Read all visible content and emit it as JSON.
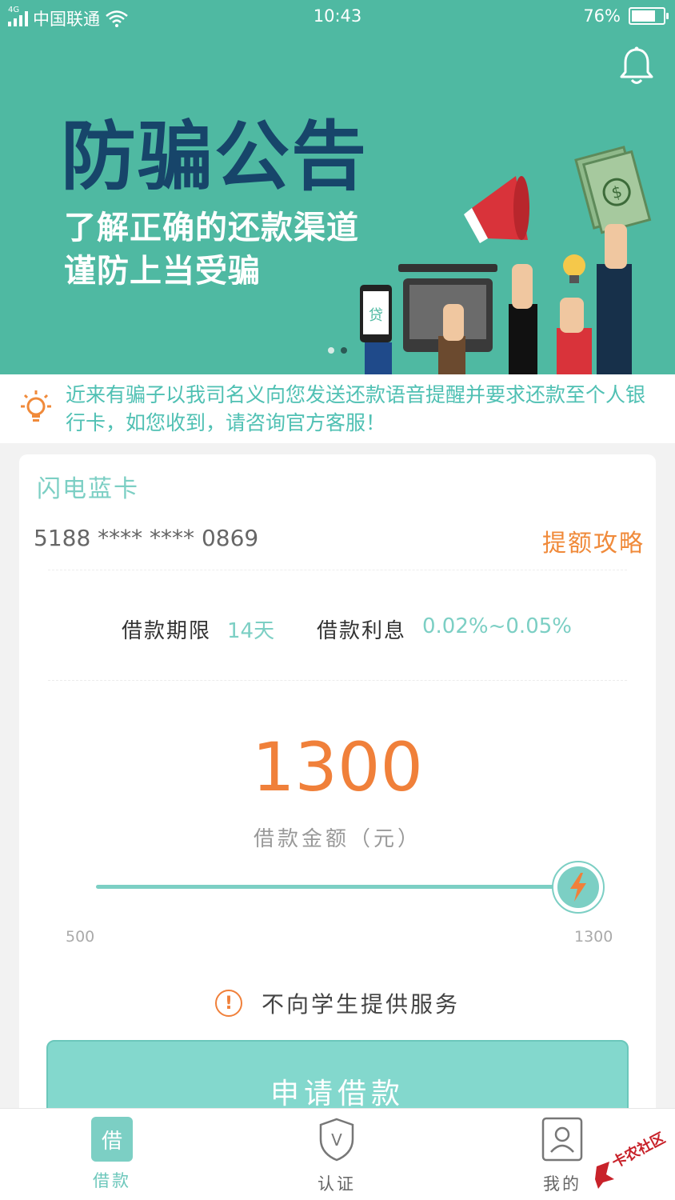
{
  "status_bar": {
    "network": "4G",
    "carrier": "中国联通",
    "time": "10:43",
    "battery": "76%",
    "battery_level": 0.76
  },
  "banner": {
    "title": "防骗公告",
    "subtitle_line1": "了解正确的还款渠道",
    "subtitle_line2": "谨防上当受骗",
    "background_color": "#4fb9a2",
    "title_color": "#17456a",
    "phone_badge": "贷",
    "page_count": 2,
    "active_page": 2
  },
  "notice": {
    "icon": "lightbulb-icon",
    "text": "近来有骗子以我司名义向您发送还款语音提醒并要求还款至个人银行卡，如您收到，请咨询官方客服！"
  },
  "card": {
    "name": "闪电蓝卡",
    "number": "5188 **** **** 0869",
    "raise_link": "提额攻略"
  },
  "loan": {
    "term_label": "借款期限",
    "term_value": "14天",
    "interest_label": "借款利息",
    "interest_value": "0.02%~0.05%",
    "amount": "1300",
    "amount_label": "借款金额（元）",
    "slider_min": "500",
    "slider_max": "1300",
    "slider_value": 1300,
    "warning": "不向学生提供服务",
    "warning_icon": "!",
    "apply_button": "申请借款"
  },
  "tabs": [
    {
      "label": "借款",
      "icon_text": "借",
      "active": true
    },
    {
      "label": "认证",
      "icon_text": "V",
      "active": false
    },
    {
      "label": "我的",
      "icon_text": "",
      "active": false
    }
  ],
  "watermark": "卡农社区",
  "colors": {
    "accent": "#7ccfc4",
    "orange": "#f0803a",
    "notice_text": "#4fc0b3"
  }
}
